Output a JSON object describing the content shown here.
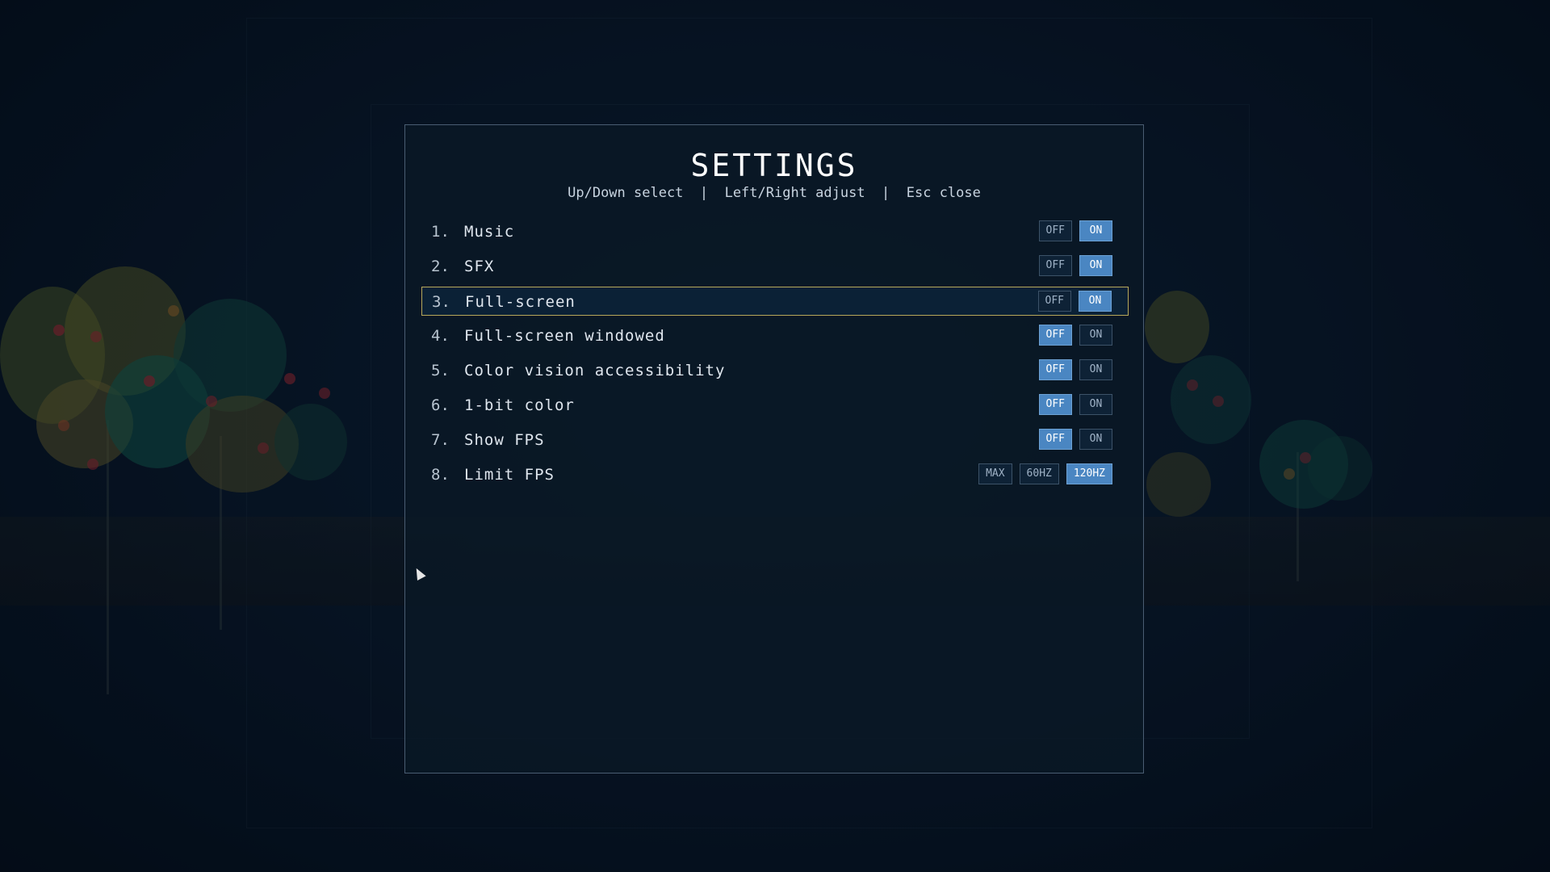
{
  "title": "SETTINGS",
  "hints": "Up/Down select  |  Left/Right adjust  |  Esc close",
  "settings": [
    {
      "num": "1.",
      "label": "Music",
      "options": [
        "OFF",
        "ON"
      ],
      "active": 1,
      "selected": false
    },
    {
      "num": "2.",
      "label": "SFX",
      "options": [
        "OFF",
        "ON"
      ],
      "active": 1,
      "selected": false
    },
    {
      "num": "3.",
      "label": "Full-screen",
      "options": [
        "OFF",
        "ON"
      ],
      "active": 1,
      "selected": true
    },
    {
      "num": "4.",
      "label": "Full-screen windowed",
      "options": [
        "OFF",
        "ON"
      ],
      "active": 0,
      "selected": false
    },
    {
      "num": "5.",
      "label": "Color vision accessibility",
      "options": [
        "OFF",
        "ON"
      ],
      "active": 0,
      "selected": false
    },
    {
      "num": "6.",
      "label": "1-bit color",
      "options": [
        "OFF",
        "ON"
      ],
      "active": 0,
      "selected": false
    },
    {
      "num": "7.",
      "label": "Show FPS",
      "options": [
        "OFF",
        "ON"
      ],
      "active": 0,
      "selected": false
    },
    {
      "num": "8.",
      "label": "Limit FPS",
      "options": [
        "MAX",
        "60HZ",
        "120HZ"
      ],
      "active": 2,
      "selected": false
    }
  ],
  "colors": {
    "active_option": "#4a86c2",
    "selection_border": "#b8a85a",
    "panel_border": "#4a5d72"
  }
}
